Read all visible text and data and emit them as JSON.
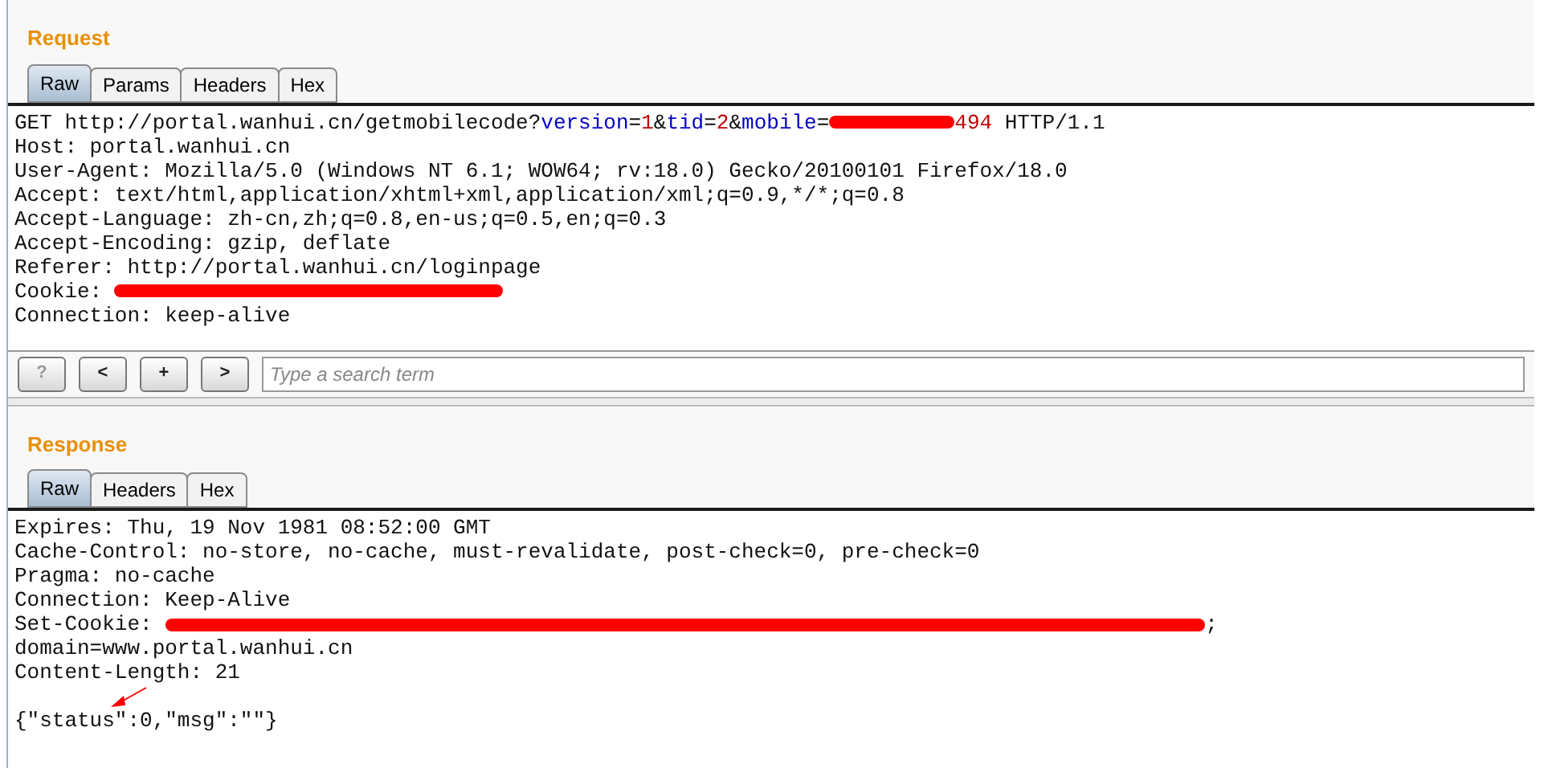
{
  "request": {
    "title": "Request",
    "tabs": [
      {
        "label": "Raw",
        "selected": true
      },
      {
        "label": "Params",
        "selected": false
      },
      {
        "label": "Headers",
        "selected": false
      },
      {
        "label": "Hex",
        "selected": false
      }
    ],
    "lines": [
      [
        {
          "kind": "plain",
          "text": "GET http://portal.wanhui.cn/getmobilecode?"
        },
        {
          "kind": "param",
          "text": "version"
        },
        {
          "kind": "plain",
          "text": "="
        },
        {
          "kind": "value",
          "text": "1"
        },
        {
          "kind": "plain",
          "text": "&"
        },
        {
          "kind": "param",
          "text": "tid"
        },
        {
          "kind": "plain",
          "text": "="
        },
        {
          "kind": "value",
          "text": "2"
        },
        {
          "kind": "plain",
          "text": "&"
        },
        {
          "kind": "param",
          "text": "mobile"
        },
        {
          "kind": "plain",
          "text": "="
        },
        {
          "kind": "redacted"
        },
        {
          "kind": "value",
          "text": "494"
        },
        {
          "kind": "plain",
          "text": " HTTP/1.1"
        }
      ],
      [
        {
          "kind": "plain",
          "text": "Host: portal.wanhui.cn"
        }
      ],
      [
        {
          "kind": "plain",
          "text": "User-Agent: Mozilla/5.0 (Windows NT 6.1; WOW64; rv:18.0) Gecko/20100101 Firefox/18.0"
        }
      ],
      [
        {
          "kind": "plain",
          "text": "Accept: text/html,application/xhtml+xml,application/xml;q=0.9,*/*;q=0.8"
        }
      ],
      [
        {
          "kind": "plain",
          "text": "Accept-Language: zh-cn,zh;q=0.8,en-us;q=0.5,en;q=0.3"
        }
      ],
      [
        {
          "kind": "plain",
          "text": "Accept-Encoding: gzip, deflate"
        }
      ],
      [
        {
          "kind": "plain",
          "text": "Referer: http://portal.wanhui.cn/loginpage"
        }
      ],
      [
        {
          "kind": "plain",
          "text": "Cookie: "
        },
        {
          "kind": "redacted"
        }
      ],
      [
        {
          "kind": "plain",
          "text": "Connection: keep-alive"
        }
      ]
    ]
  },
  "search_bar": {
    "buttons": [
      "?",
      "<",
      "+",
      ">"
    ],
    "placeholder": "Type a search term"
  },
  "response": {
    "title": "Response",
    "tabs": [
      {
        "label": "Raw",
        "selected": true
      },
      {
        "label": "Headers",
        "selected": false
      },
      {
        "label": "Hex",
        "selected": false
      }
    ],
    "lines": [
      [
        {
          "kind": "plain",
          "text": "Expires: Thu, 19 Nov 1981 08:52:00 GMT"
        }
      ],
      [
        {
          "kind": "plain",
          "text": "Cache-Control: no-store, no-cache, must-revalidate, post-check=0, pre-check=0"
        }
      ],
      [
        {
          "kind": "plain",
          "text": "Pragma: no-cache"
        }
      ],
      [
        {
          "kind": "plain",
          "text": "Connection: Keep-Alive"
        }
      ],
      [
        {
          "kind": "plain",
          "text": "Set-Cookie: "
        },
        {
          "kind": "redacted"
        },
        {
          "kind": "plain",
          "text": ";"
        }
      ],
      [
        {
          "kind": "plain",
          "text": "domain=www.portal.wanhui.cn"
        }
      ],
      [
        {
          "kind": "plain",
          "text": "Content-Length: 21"
        }
      ],
      [
        {
          "kind": "annotated",
          "text": "{\"status\":0,\"msg\":\"\"}"
        }
      ]
    ]
  }
}
